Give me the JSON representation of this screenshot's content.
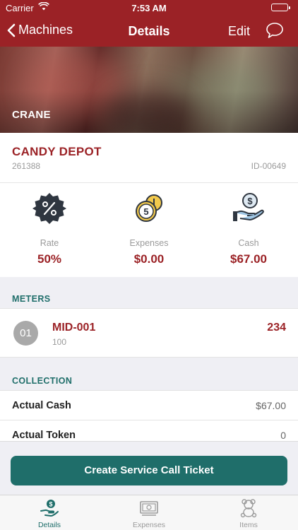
{
  "status_bar": {
    "carrier": "Carrier",
    "time": "7:53 AM"
  },
  "nav": {
    "back_label": "Machines",
    "title": "Details",
    "edit_label": "Edit"
  },
  "hero": {
    "label": "CRANE"
  },
  "machine": {
    "name": "CANDY DEPOT",
    "code": "261388",
    "id": "ID-00649"
  },
  "stats": [
    {
      "label": "Rate",
      "value": "50%",
      "icon": "percent-badge-icon"
    },
    {
      "label": "Expenses",
      "value": "$0.00",
      "icon": "coins-icon"
    },
    {
      "label": "Cash",
      "value": "$67.00",
      "icon": "hand-money-icon"
    }
  ],
  "meters": {
    "heading": "METERS",
    "items": [
      {
        "badge": "01",
        "name": "MID-001",
        "sub": "100",
        "value": "234"
      }
    ]
  },
  "collection": {
    "heading": "COLLECTION",
    "rows": [
      {
        "label": "Actual Cash",
        "value": "$67.00"
      },
      {
        "label": "Actual Token",
        "value": "0"
      }
    ]
  },
  "cta": {
    "label": "Create Service Call Ticket"
  },
  "tabs": [
    {
      "label": "Details",
      "icon": "hand-money-icon",
      "active": true
    },
    {
      "label": "Expenses",
      "icon": "receipt-icon",
      "active": false
    },
    {
      "label": "Items",
      "icon": "teddy-bear-icon",
      "active": false
    }
  ],
  "colors": {
    "brand": "#9b2226",
    "accent": "#1f6e6a",
    "battery": "#4cd964"
  }
}
